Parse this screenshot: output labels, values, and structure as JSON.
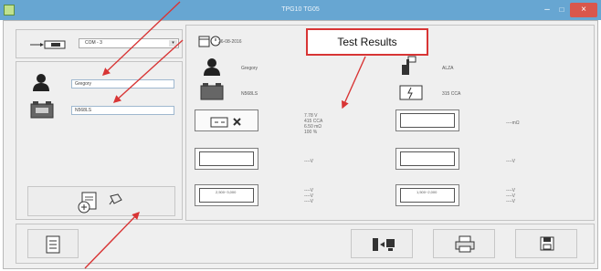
{
  "window": {
    "title": "TPG10 TG05",
    "minimize_glyph": "–",
    "maximize_glyph": "□",
    "close_glyph": "×"
  },
  "connection": {
    "port": "COM - 3",
    "dropdown_glyph": "▾"
  },
  "customer": {
    "name": "Gregory",
    "battery_model": "N568LS"
  },
  "summary": {
    "date": "26-08-2016",
    "customer": "Gregory",
    "tester": "ALZA",
    "cca_rating": "315 CCA"
  },
  "callout": {
    "label": "Test Results"
  },
  "results": {
    "voltage": "7.78 V",
    "cca": "415 CCA",
    "resistance": "6.50 mΩ",
    "health": "100 %",
    "resistance_unit": "----mΩ",
    "starter_voltage": "----V",
    "alternator_voltage": "----V",
    "load_line1": "----V",
    "load_line2": "----V",
    "load_line3": "----V",
    "load2_line1": "----V",
    "load2_line2": "----V",
    "load2_line3": "----V"
  },
  "tiles": {
    "load_rpm_left": "2,500~3,000",
    "load_rpm_right": "1,500~2,000"
  },
  "colors": {
    "titlebar": "#67a6d2",
    "close": "#d9574c",
    "callout_border": "#d83535",
    "arrow": "#d83535"
  }
}
